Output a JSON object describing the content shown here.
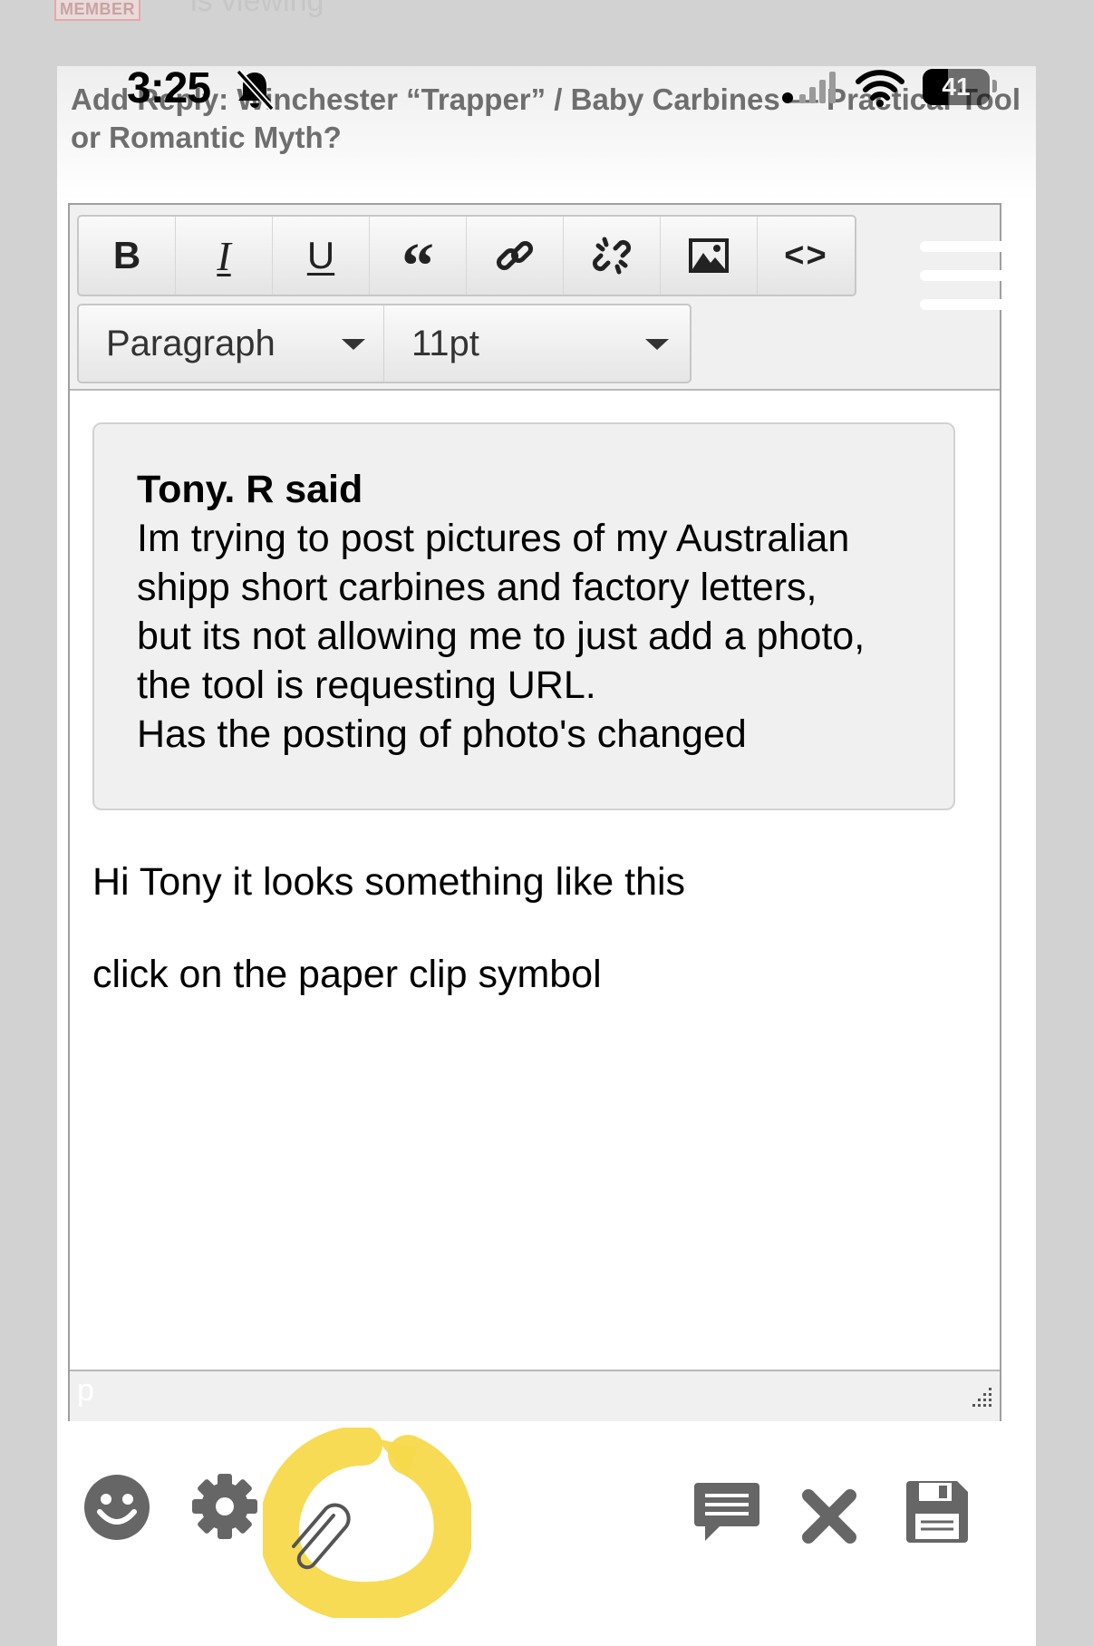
{
  "background": {
    "badge": "MEMBER",
    "viewing_text": "is viewing"
  },
  "status_bar": {
    "time": "3:25",
    "battery": "41",
    "icons": [
      "bell-slash-icon",
      "signal-icon",
      "wifi-icon",
      "battery-icon"
    ]
  },
  "modal": {
    "title": "Add Reply: Winchester “Trapper” / Baby Carbines — Practical Tool or Romantic Myth?"
  },
  "toolbar": {
    "buttons": [
      {
        "label": "B",
        "name": "bold-button"
      },
      {
        "label": "I",
        "name": "italic-button"
      },
      {
        "label": "U",
        "name": "underline-button"
      },
      {
        "label": "“",
        "name": "blockquote-button"
      },
      {
        "icon": "link-icon",
        "name": "insert-link-button"
      },
      {
        "icon": "unlink-icon",
        "name": "remove-link-button"
      },
      {
        "icon": "image-icon",
        "name": "insert-image-button"
      },
      {
        "label": "<>",
        "name": "source-code-button"
      }
    ],
    "format_select": "Paragraph",
    "font_size_select": "11pt"
  },
  "editor": {
    "quote": {
      "author": "Tony. R said",
      "lines": [
        "Im trying to post pictures of my Australian",
        "shipp short carbines and factory letters,",
        "but its not allowing me to just add a photo,",
        "the tool is requesting URL.",
        "Has the posting of photo's changed"
      ]
    },
    "reply_lines": [
      "Hi Tony it looks something like this",
      "click on the paper clip symbol"
    ],
    "element_path": "p"
  },
  "bottom_toolbar": {
    "left_icons": [
      "smiley-icon",
      "gear-icon",
      "paperclip-icon"
    ],
    "right_icons": [
      "comment-icon",
      "close-icon",
      "save-icon"
    ],
    "highlight_color": "#f7d94c"
  }
}
